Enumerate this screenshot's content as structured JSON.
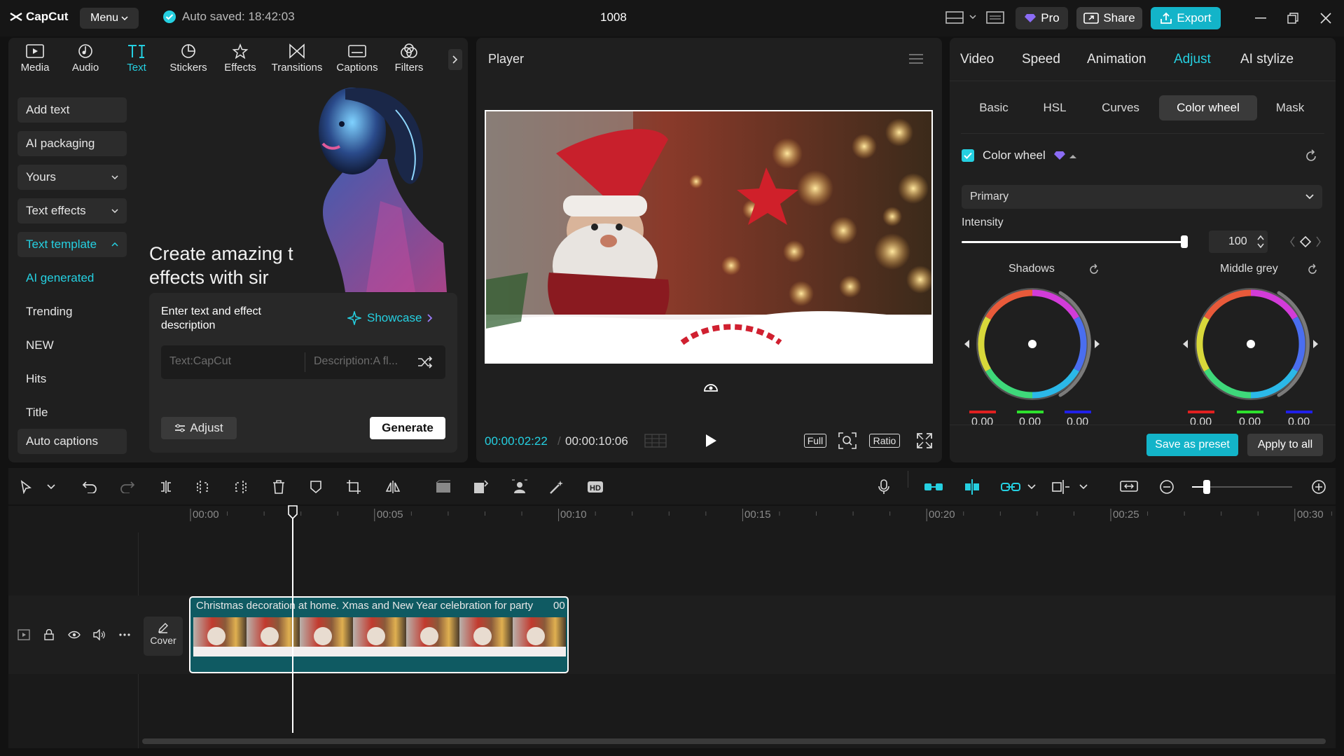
{
  "app": {
    "logo_text": "CapCut",
    "menu_label": "Menu",
    "autosave_text": "Auto saved: 18:42:03",
    "project_title": "1008"
  },
  "topbar": {
    "pro_label": "Pro",
    "share_label": "Share",
    "export_label": "Export"
  },
  "toolbar": {
    "items": [
      {
        "label": "Media",
        "icon": "media-icon"
      },
      {
        "label": "Audio",
        "icon": "audio-icon"
      },
      {
        "label": "Text",
        "icon": "text-icon"
      },
      {
        "label": "Stickers",
        "icon": "stickers-icon"
      },
      {
        "label": "Effects",
        "icon": "effects-icon"
      },
      {
        "label": "Transitions",
        "icon": "transitions-icon"
      },
      {
        "label": "Captions",
        "icon": "captions-icon"
      },
      {
        "label": "Filters",
        "icon": "filters-icon"
      }
    ],
    "active": "Text"
  },
  "sidebar": {
    "items": [
      {
        "label": "Add text"
      },
      {
        "label": "AI packaging"
      },
      {
        "label": "Yours"
      },
      {
        "label": "Text effects"
      },
      {
        "label": "Text template"
      },
      {
        "label": "AI generated"
      },
      {
        "label": "Trending"
      },
      {
        "label": "NEW"
      },
      {
        "label": "Hits"
      },
      {
        "label": "Title"
      },
      {
        "label": "Auto captions"
      }
    ]
  },
  "promo": {
    "headline_line1": "Create amazing t",
    "headline_line2": "effects with sir",
    "prompt_title": "Enter text and effect description",
    "showcase_label": "Showcase",
    "text_placeholder": "Text:CapCut",
    "desc_placeholder": "Description:A fl...",
    "adjust_label": "Adjust",
    "generate_label": "Generate"
  },
  "player": {
    "title": "Player",
    "current_time": "00:00:02:22",
    "total_time": "00:00:10:06",
    "full_label": "Full",
    "ratio_label": "Ratio"
  },
  "inspector": {
    "tabs": [
      "Video",
      "Speed",
      "Animation",
      "Adjust",
      "AI stylize"
    ],
    "active_tab": "Adjust",
    "subtabs": [
      "Basic",
      "HSL",
      "Curves",
      "Color wheel",
      "Mask"
    ],
    "active_subtab": "Color wheel",
    "section_label": "Color wheel",
    "mode_value": "Primary",
    "intensity_label": "Intensity",
    "intensity_value": "100",
    "intensity_fraction": 1.0,
    "wheels": [
      {
        "label": "Shadows",
        "values": [
          "0.00",
          "0.00",
          "0.00"
        ]
      },
      {
        "label": "Middle grey",
        "values": [
          "0.00",
          "0.00",
          "0.00"
        ]
      }
    ],
    "save_preset_label": "Save as preset",
    "apply_all_label": "Apply to all"
  },
  "timeline": {
    "ticks": [
      "00:00",
      "00:05",
      "00:10",
      "00:15",
      "00:20",
      "00:25",
      "00:30"
    ],
    "cover_label": "Cover",
    "clip_title": "Christmas decoration at home. Xmas and New Year celebration for party",
    "clip_suffix": "00"
  },
  "colors": {
    "accent": "#25d0e1",
    "export": "#13b4c9",
    "pro": "#8b6cf6",
    "clip_bg": "#0f5a62"
  }
}
